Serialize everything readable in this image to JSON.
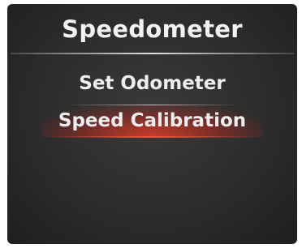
{
  "screen": {
    "title": "Speedometer",
    "menu": {
      "items": [
        {
          "label": "Set Odometer",
          "selected": false
        },
        {
          "label": "Speed Calibration",
          "selected": true
        }
      ]
    }
  },
  "colors": {
    "background": "#2c2c2c",
    "text": "#eeeeee",
    "selection": "#d23c28"
  }
}
